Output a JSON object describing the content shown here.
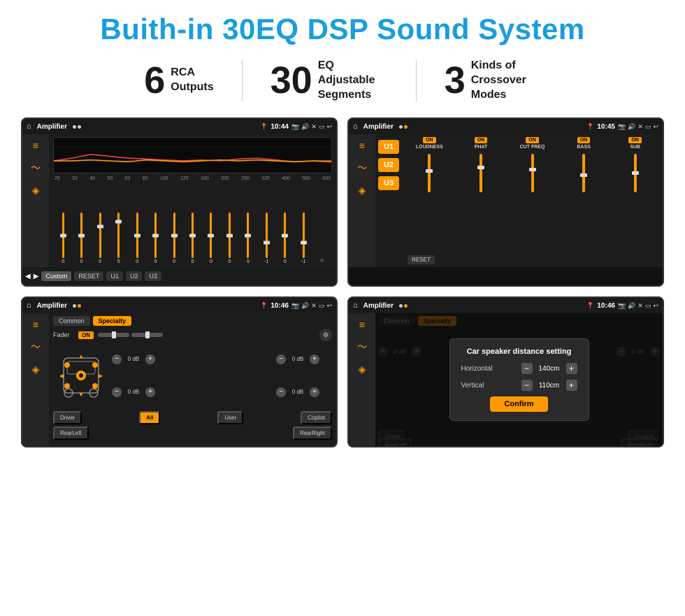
{
  "page": {
    "title": "Buith-in 30EQ DSP Sound System",
    "stats": [
      {
        "number": "6",
        "text": "RCA\nOutputs"
      },
      {
        "number": "30",
        "text": "EQ Adjustable\nSegments"
      },
      {
        "number": "3",
        "text": "Kinds of\nCrossover Modes"
      }
    ]
  },
  "screen1": {
    "statusBar": {
      "appTitle": "Amplifier",
      "time": "10:44"
    },
    "freqLabels": [
      "25",
      "32",
      "40",
      "50",
      "63",
      "80",
      "100",
      "125",
      "160",
      "200",
      "250",
      "320",
      "400",
      "500",
      "630"
    ],
    "sliderValues": [
      "0",
      "0",
      "0",
      "5",
      "0",
      "0",
      "0",
      "0",
      "0",
      "0",
      "0",
      "-1",
      "0",
      "-1"
    ],
    "buttons": [
      "Custom",
      "RESET",
      "U1",
      "U2",
      "U3"
    ]
  },
  "screen2": {
    "statusBar": {
      "appTitle": "Amplifier",
      "time": "10:45"
    },
    "uButtons": [
      "U1",
      "U2",
      "U3"
    ],
    "params": [
      {
        "name": "LOUDNESS",
        "on": true
      },
      {
        "name": "PHAT",
        "on": true
      },
      {
        "name": "CUT FREQ",
        "on": true
      },
      {
        "name": "BASS",
        "on": true
      },
      {
        "name": "SUB",
        "on": true
      }
    ],
    "resetLabel": "RESET"
  },
  "screen3": {
    "statusBar": {
      "appTitle": "Amplifier",
      "time": "10:46"
    },
    "tabs": [
      "Common",
      "Specialty"
    ],
    "activeTab": 1,
    "faderLabel": "Fader",
    "faderToggle": "ON",
    "volumes": [
      {
        "label": "0 dB",
        "side": "left"
      },
      {
        "label": "0 dB",
        "side": "right"
      },
      {
        "label": "0 dB",
        "side": "left"
      },
      {
        "label": "0 dB",
        "side": "right"
      }
    ],
    "bottomButtons": [
      "Driver",
      "All",
      "User",
      "Copilot",
      "RearLeft",
      "RearRight"
    ]
  },
  "screen4": {
    "statusBar": {
      "appTitle": "Amplifier",
      "time": "10:46"
    },
    "tabs": [
      "Common",
      "Specialty"
    ],
    "dialog": {
      "title": "Car speaker distance setting",
      "params": [
        {
          "name": "Horizontal",
          "value": "140cm"
        },
        {
          "name": "Vertical",
          "value": "110cm"
        }
      ],
      "confirmLabel": "Confirm"
    },
    "volumes": [
      {
        "label": "0 dB"
      },
      {
        "label": "0 dB"
      }
    ],
    "bottomButtons": [
      "Driver",
      "Copilot",
      "RearLeft",
      "RearRight"
    ]
  },
  "icons": {
    "home": "⌂",
    "location": "📍",
    "volume": "🔊",
    "settings": "⚙",
    "eq": "≡",
    "wave": "〜",
    "speaker": "◈"
  }
}
